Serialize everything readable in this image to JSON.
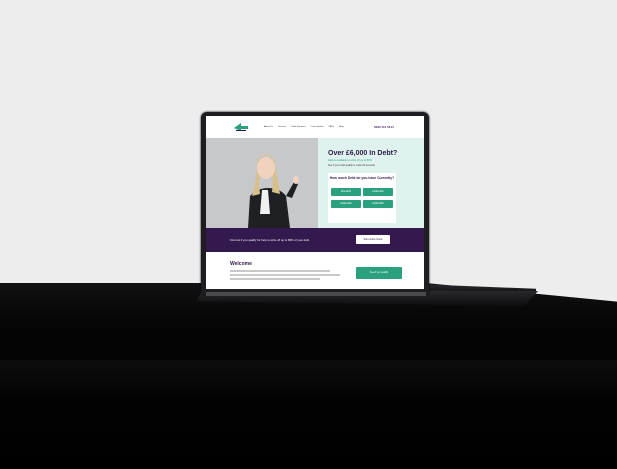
{
  "colors": {
    "background": "#ededed",
    "table": "#000000",
    "brand_purple": "#34194f",
    "brand_green": "#2aa07e",
    "hero_mint": "#dff2ed"
  },
  "website": {
    "logo_icon": "leaf-arrow-logo-icon",
    "nav_links": [
      "About Us",
      "Services",
      "Debt Solutions",
      "Case Studies",
      "FAQs",
      "Blog"
    ],
    "phone": "0330 111 5414",
    "headline": "Over £6,000 In Debt?",
    "subline": "Help is available to write off up to 80%",
    "subline2": "See if you could qualify in under 60 seconds",
    "question": "How much Debt do you have Currently?",
    "options": [
      "£6k-£10k",
      "£10k-£20k",
      "£20k-£40k",
      "£40k-£60k"
    ],
    "band_text": "Find out if you qualify for help to write off up to 80% of your debt",
    "band_button": "Start online check",
    "welcome": "Welcome",
    "welcome_button": "See if you qualify"
  }
}
